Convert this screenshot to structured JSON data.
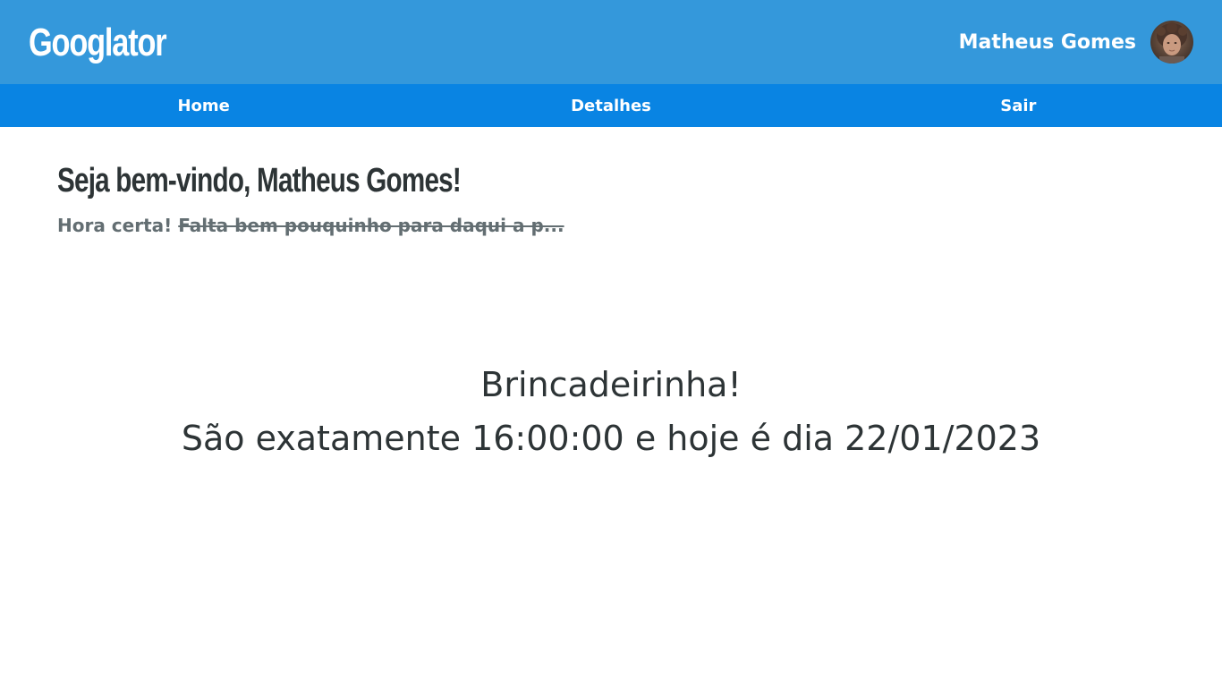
{
  "header": {
    "logo": "Googlator",
    "user_name": "Matheus Gomes",
    "avatar_icon": "user-avatar-photo"
  },
  "nav": {
    "items": [
      {
        "label": "Home"
      },
      {
        "label": "Detalhes"
      },
      {
        "label": "Sair"
      }
    ]
  },
  "main": {
    "welcome": "Seja bem-vindo, Matheus Gomes!",
    "subtitle_prefix": "Hora certa!",
    "subtitle_struck": "Falta bem pouquinho para daqui a p...",
    "joke_line1": "Brincadeirinha!",
    "joke_line2": "São exatamente 16:00:00 e hoje é dia 22/01/2023"
  },
  "colors": {
    "header_bg": "#3498db",
    "nav_bg": "#0984e3",
    "heading_text": "#2d3436",
    "muted_text": "#636e72"
  }
}
